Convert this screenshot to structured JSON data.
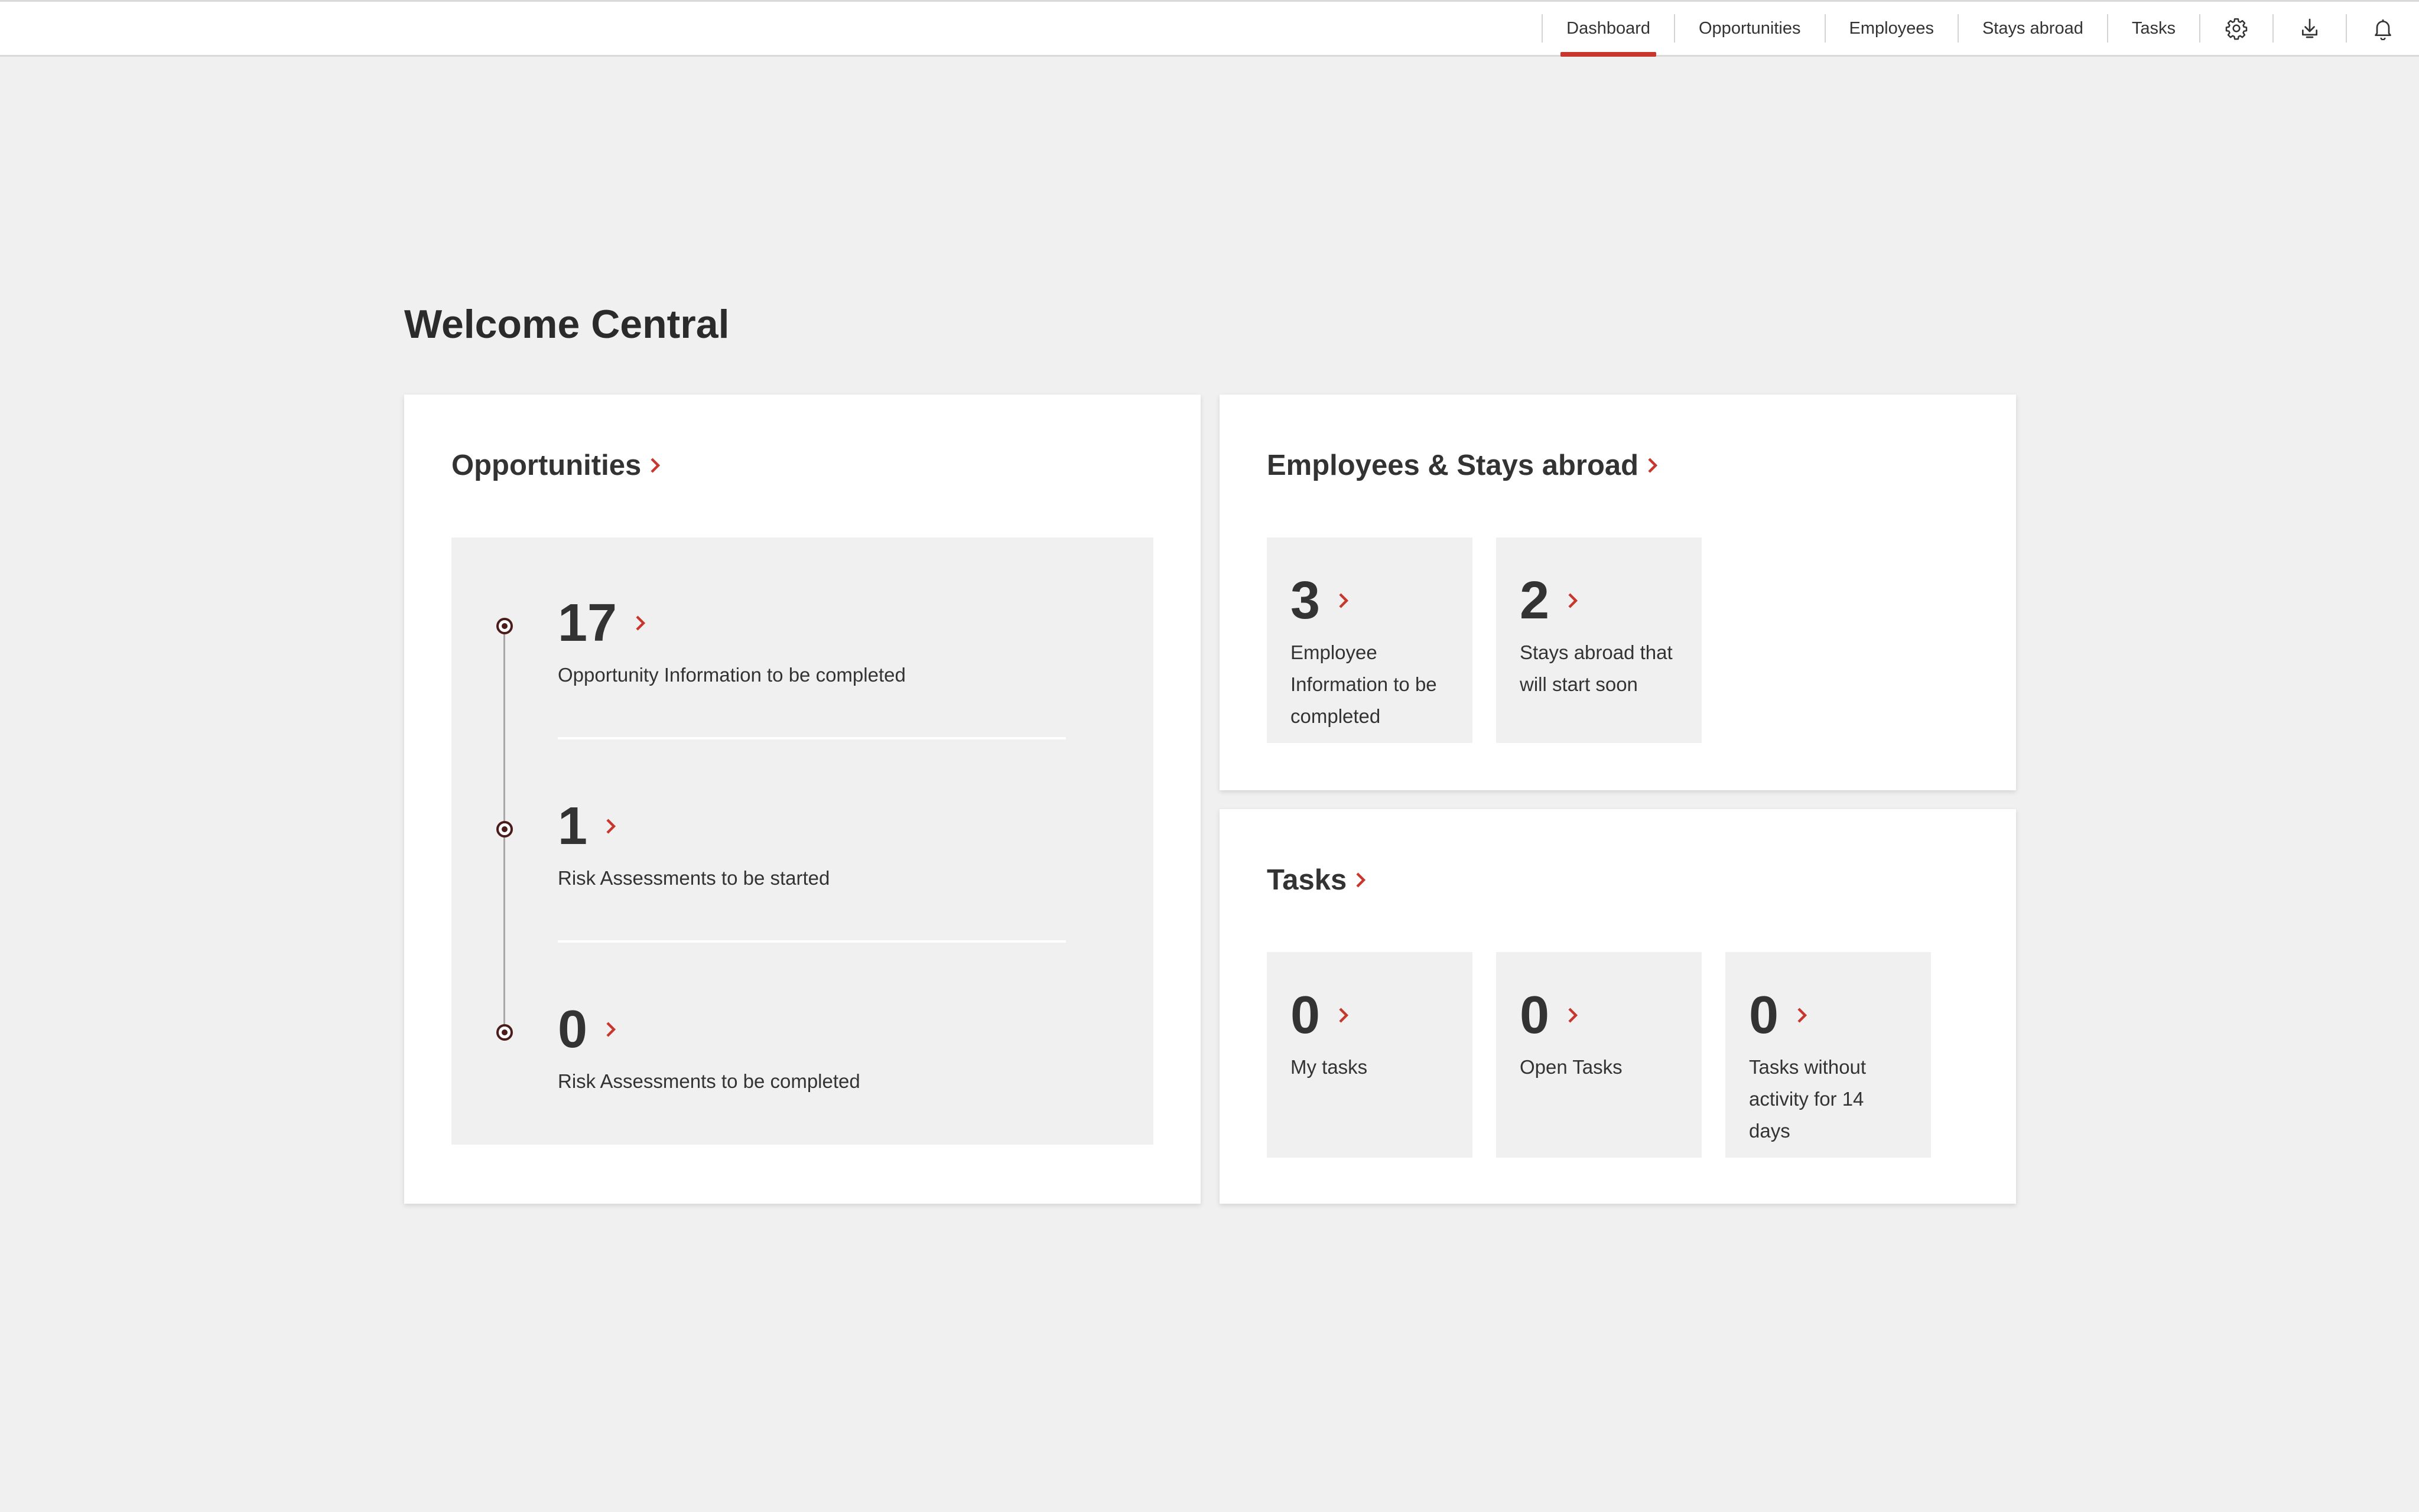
{
  "nav": {
    "items": [
      {
        "label": "Dashboard",
        "active": true
      },
      {
        "label": "Opportunities",
        "active": false
      },
      {
        "label": "Employees",
        "active": false
      },
      {
        "label": "Stays abroad",
        "active": false
      },
      {
        "label": "Tasks",
        "active": false
      }
    ],
    "icons": [
      "gear-icon",
      "download-icon",
      "bell-icon"
    ]
  },
  "page": {
    "title": "Welcome Central"
  },
  "opportunities_card": {
    "title": "Opportunities",
    "entries": [
      {
        "count": "17",
        "label": "Opportunity Information to be completed"
      },
      {
        "count": "1",
        "label": "Risk Assessments to be started"
      },
      {
        "count": "0",
        "label": "Risk Assessments to be completed"
      }
    ]
  },
  "employees_card": {
    "title": "Employees & Stays abroad",
    "tiles": [
      {
        "count": "3",
        "label": "Employee Information to be completed"
      },
      {
        "count": "2",
        "label": "Stays abroad that will start soon"
      }
    ]
  },
  "tasks_card": {
    "title": "Tasks",
    "tiles": [
      {
        "count": "0",
        "label": "My tasks"
      },
      {
        "count": "0",
        "label": "Open Tasks"
      },
      {
        "count": "0",
        "label": "Tasks without activity for 14 days"
      }
    ]
  },
  "colors": {
    "accent": "#c8372d",
    "background": "#f0f0f0",
    "card": "#ffffff",
    "text": "#333333"
  }
}
